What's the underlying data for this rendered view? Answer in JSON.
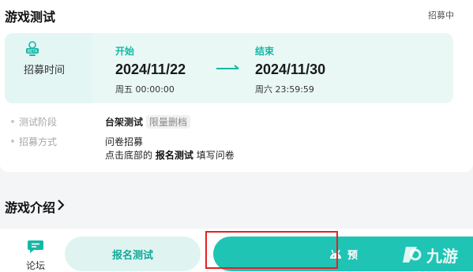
{
  "section": {
    "title": "游戏测试",
    "status": "招募中"
  },
  "time_panel": {
    "label": "招募时间",
    "start_label": "开始",
    "start_date": "2024/11/22",
    "start_time": "周五 00:00:00",
    "end_label": "结束",
    "end_date": "2024/11/30",
    "end_time": "周六 23:59:59"
  },
  "info": {
    "stage_key": "测试阶段",
    "stage_value": "台架测试",
    "stage_tag": "限量删档",
    "method_key": "招募方式",
    "method_line1": "问卷招募",
    "method_line2_pre": "点击底部的",
    "method_line2_bold": "报名测试",
    "method_line2_post": "填写问卷"
  },
  "intro": {
    "title": "游戏介绍"
  },
  "bottom_bar": {
    "forum_label": "论坛",
    "signup_label": "报名测试",
    "download_label": "预"
  },
  "watermark": {
    "text": "九游"
  },
  "colors": {
    "accent": "#1fc4b4",
    "accent_text": "#14b8a6",
    "panel_bg": "#e3f6f3",
    "frame": "#e52025"
  },
  "icons": {
    "beta": "beta-badge-icon",
    "arrow": "arrow-right-icon",
    "chevron": "chevron-right-icon",
    "forum": "chat-bubble-icon",
    "android": "android-icon"
  }
}
